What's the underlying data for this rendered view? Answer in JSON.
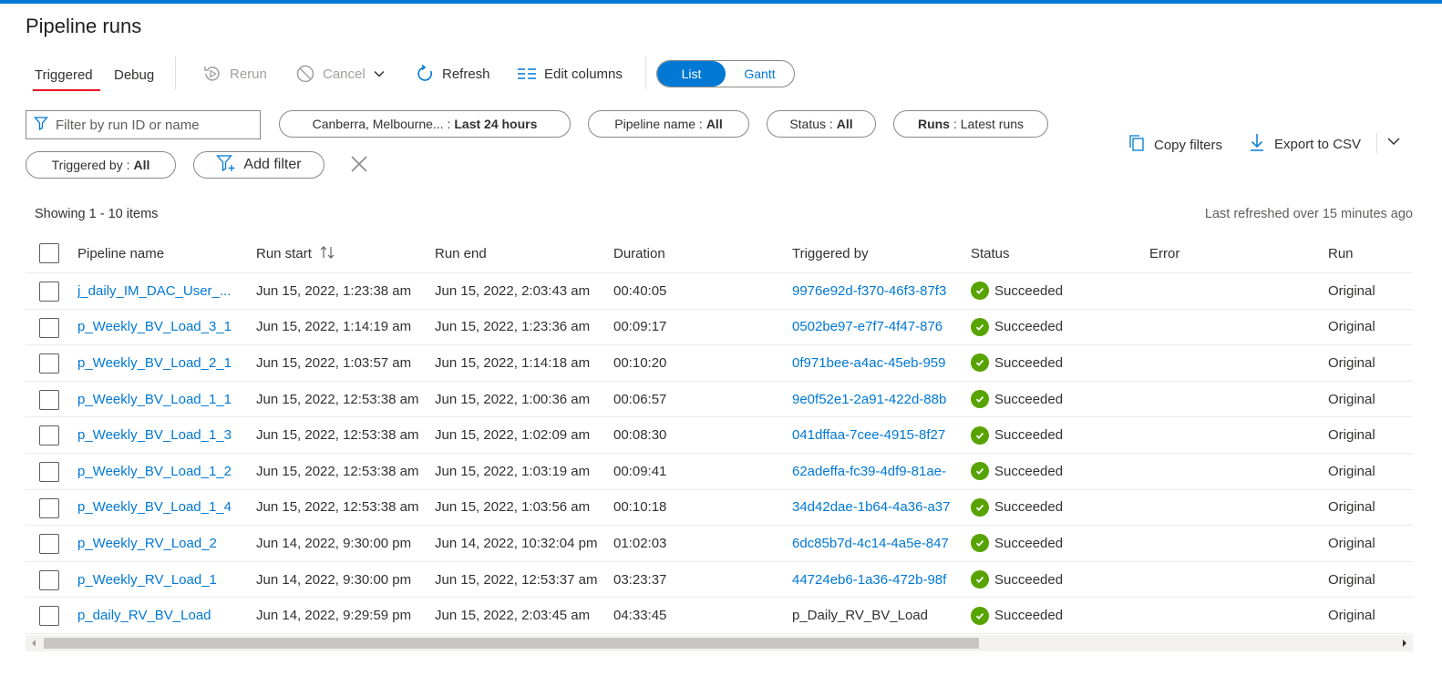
{
  "page": {
    "title": "Pipeline runs"
  },
  "tabs": [
    {
      "label": "Triggered"
    },
    {
      "label": "Debug"
    }
  ],
  "toolbar": {
    "rerun": "Rerun",
    "cancel": "Cancel",
    "refresh": "Refresh",
    "edit_columns": "Edit columns"
  },
  "view_toggle": {
    "list": "List",
    "gantt": "Gantt",
    "selected": "List"
  },
  "search": {
    "placeholder": "Filter by run ID or name",
    "value": ""
  },
  "filters": {
    "timezone": {
      "label": "Canberra, Melbourne... :",
      "value": "Last 24 hours"
    },
    "pipeline_name": {
      "label": "Pipeline name :",
      "value": "All"
    },
    "status": {
      "label": "Status :",
      "value": "All"
    },
    "runs": {
      "label": "Runs",
      "value": ": Latest runs"
    },
    "triggered_by": {
      "label": "Triggered by :",
      "value": "All"
    },
    "add_filter": "Add filter"
  },
  "actions": {
    "copy_filters": "Copy filters",
    "export_csv": "Export to CSV"
  },
  "info": {
    "showing": "Showing 1 - 10 items",
    "last_refreshed": "Last refreshed over 15 minutes ago"
  },
  "columns": [
    "Pipeline name",
    "Run start",
    "Run end",
    "Duration",
    "Triggered by",
    "Status",
    "Error",
    "Run"
  ],
  "rows": [
    {
      "name": "j_daily_IM_DAC_User_...",
      "start": "Jun 15, 2022, 1:23:38 am",
      "end": "Jun 15, 2022, 2:03:43 am",
      "duration": "00:40:05",
      "triggered_by": "9976e92d-f370-46f3-87f3",
      "triggered_is_link": true,
      "status": "Succeeded",
      "error": "",
      "run": "Original"
    },
    {
      "name": "p_Weekly_BV_Load_3_1",
      "start": "Jun 15, 2022, 1:14:19 am",
      "end": "Jun 15, 2022, 1:23:36 am",
      "duration": "00:09:17",
      "triggered_by": "0502be97-e7f7-4f47-876",
      "triggered_is_link": true,
      "status": "Succeeded",
      "error": "",
      "run": "Original"
    },
    {
      "name": "p_Weekly_BV_Load_2_1",
      "start": "Jun 15, 2022, 1:03:57 am",
      "end": "Jun 15, 2022, 1:14:18 am",
      "duration": "00:10:20",
      "triggered_by": "0f971bee-a4ac-45eb-959",
      "triggered_is_link": true,
      "status": "Succeeded",
      "error": "",
      "run": "Original"
    },
    {
      "name": "p_Weekly_BV_Load_1_1",
      "start": "Jun 15, 2022, 12:53:38 am",
      "end": "Jun 15, 2022, 1:00:36 am",
      "duration": "00:06:57",
      "triggered_by": "9e0f52e1-2a91-422d-88b",
      "triggered_is_link": true,
      "status": "Succeeded",
      "error": "",
      "run": "Original"
    },
    {
      "name": "p_Weekly_BV_Load_1_3",
      "start": "Jun 15, 2022, 12:53:38 am",
      "end": "Jun 15, 2022, 1:02:09 am",
      "duration": "00:08:30",
      "triggered_by": "041dffaa-7cee-4915-8f27",
      "triggered_is_link": true,
      "status": "Succeeded",
      "error": "",
      "run": "Original"
    },
    {
      "name": "p_Weekly_BV_Load_1_2",
      "start": "Jun 15, 2022, 12:53:38 am",
      "end": "Jun 15, 2022, 1:03:19 am",
      "duration": "00:09:41",
      "triggered_by": "62adeffa-fc39-4df9-81ae-",
      "triggered_is_link": true,
      "status": "Succeeded",
      "error": "",
      "run": "Original"
    },
    {
      "name": "p_Weekly_BV_Load_1_4",
      "start": "Jun 15, 2022, 12:53:38 am",
      "end": "Jun 15, 2022, 1:03:56 am",
      "duration": "00:10:18",
      "triggered_by": "34d42dae-1b64-4a36-a37",
      "triggered_is_link": true,
      "status": "Succeeded",
      "error": "",
      "run": "Original"
    },
    {
      "name": "p_Weekly_RV_Load_2",
      "start": "Jun 14, 2022, 9:30:00 pm",
      "end": "Jun 14, 2022, 10:32:04 pm",
      "duration": "01:02:03",
      "triggered_by": "6dc85b7d-4c14-4a5e-847",
      "triggered_is_link": true,
      "status": "Succeeded",
      "error": "",
      "run": "Original"
    },
    {
      "name": "p_Weekly_RV_Load_1",
      "start": "Jun 14, 2022, 9:30:00 pm",
      "end": "Jun 15, 2022, 12:53:37 am",
      "duration": "03:23:37",
      "triggered_by": "44724eb6-1a36-472b-98f",
      "triggered_is_link": true,
      "status": "Succeeded",
      "error": "",
      "run": "Original"
    },
    {
      "name": "p_daily_RV_BV_Load",
      "start": "Jun 14, 2022, 9:29:59 pm",
      "end": "Jun 15, 2022, 2:03:45 am",
      "duration": "04:33:45",
      "triggered_by": "p_Daily_RV_BV_Load",
      "triggered_is_link": false,
      "status": "Succeeded",
      "error": "",
      "run": "Original"
    }
  ],
  "colors": {
    "accent": "#0078d4",
    "success": "#57a300",
    "tab_underline": "#e81123"
  }
}
